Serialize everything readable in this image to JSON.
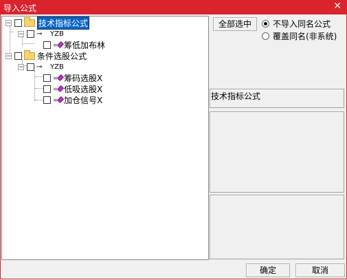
{
  "window": {
    "title": "导入公式",
    "close_glyph": "✕"
  },
  "tree": {
    "root1": {
      "label": "技术指标公式",
      "toggle": "−"
    },
    "root1_group": {
      "label": "YZB",
      "toggle": "−"
    },
    "root1_items": [
      {
        "label": "筹低加布林"
      }
    ],
    "root2": {
      "label": "条件选股公式",
      "toggle": "−"
    },
    "root2_group": {
      "label": "YZB",
      "toggle": "−"
    },
    "root2_items": [
      {
        "label": "筹码选股X"
      },
      {
        "label": "低吸选股X"
      },
      {
        "label": "加仓信号X"
      }
    ]
  },
  "options": {
    "select_all": "全部选中",
    "radio_skip_label": "不导入同名公式",
    "radio_overwrite_label": "覆盖同名(非系统)",
    "selected": "skip"
  },
  "info": {
    "category_text": "技术指标公式"
  },
  "footer": {
    "ok": "确定",
    "cancel": "取消"
  }
}
